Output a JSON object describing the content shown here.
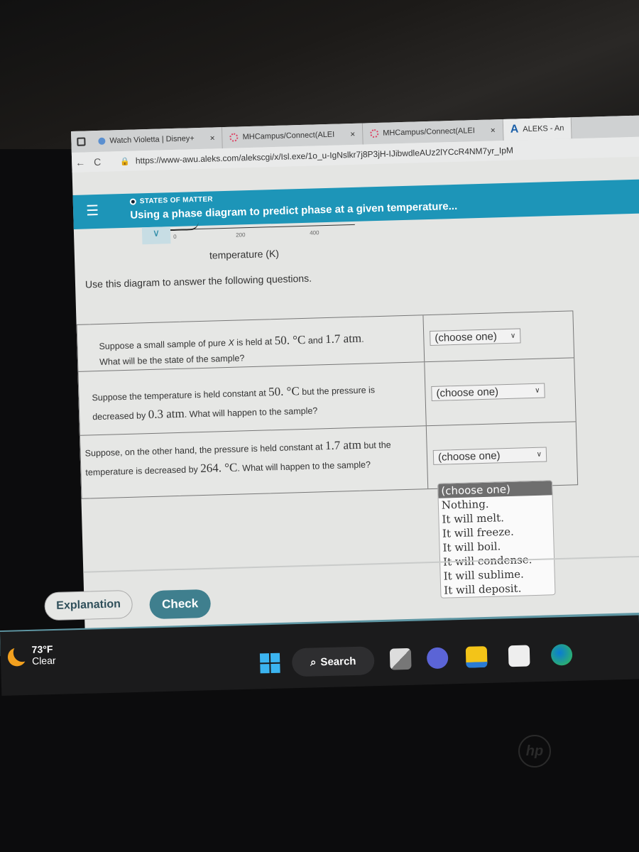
{
  "browser": {
    "tabs": [
      {
        "label": "Watch Violetta | Disney+",
        "icon": "disney-favicon",
        "close": "×"
      },
      {
        "label": "MHCampus/Connect(ALEI",
        "icon": "mhcampus-favicon",
        "close": "×"
      },
      {
        "label": "MHCampus/Connect(ALEI",
        "icon": "mhcampus-favicon",
        "close": "×"
      },
      {
        "label": "ALEKS - An",
        "icon": "aleks-favicon",
        "icon_glyph": "A"
      }
    ],
    "url": "https://www-awu.aleks.com/alekscgi/x/Isl.exe/1o_u-IgNslkr7j8P3jH-IJibwdleAUz2lYCcR4NM7yr_IpM",
    "back_glyph": "←",
    "reload_glyph": "C",
    "lock_glyph": "🔒"
  },
  "aleks": {
    "menu_glyph": "☰",
    "topic": "STATES OF MATTER",
    "title": "Using a phase diagram to predict phase at a given temperature...",
    "collapse_glyph": "∨",
    "axis": {
      "ticks": [
        "0",
        "200",
        "400"
      ],
      "label": "temperature (K)"
    },
    "instructions": "Use this diagram to answer the following questions.",
    "questions": [
      {
        "parts": [
          "Suppose a small sample of pure ",
          "X",
          " is held at ",
          "50. °C",
          " and ",
          "1.7 atm",
          ".",
          "What will be the state of the sample?"
        ],
        "answer": "(choose one)"
      },
      {
        "parts": [
          "Suppose the temperature is held constant at ",
          "50. °C",
          " but the pressure is decreased by ",
          "0.3 atm",
          ". What will happen to the sample?"
        ],
        "answer": "(choose one)"
      },
      {
        "parts": [
          "Suppose, on the other hand, the pressure is held constant at ",
          "1.7 atm",
          " but the temperature is decreased by ",
          "264. °C",
          ". What will happen to the sample?"
        ],
        "answer": "(choose one)"
      }
    ],
    "dropdown_options": [
      "(choose one)",
      "Nothing.",
      "It will melt.",
      "It will freeze.",
      "It will boil.",
      "It will condense.",
      "It will sublime.",
      "It will deposit."
    ],
    "dropdown_selected": "(choose one)",
    "buttons": {
      "explanation": "Explanation",
      "check": "Check"
    },
    "colors": {
      "header": "#1d95b8",
      "check_button": "#3f7f8e"
    }
  },
  "taskbar": {
    "weather": {
      "temp": "73°F",
      "desc": "Clear"
    },
    "search_label": "Search",
    "search_glyph": "⌕"
  },
  "laptop": {
    "brand": "hp"
  }
}
